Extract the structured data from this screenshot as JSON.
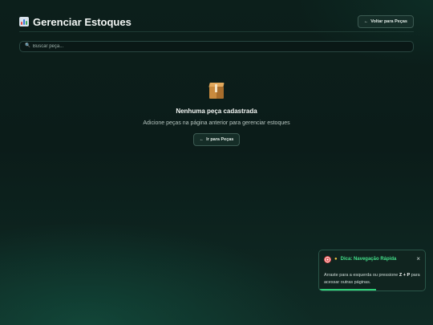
{
  "header": {
    "title": "Gerenciar Estoques",
    "back_label": "Voltar para Peças",
    "back_arrow": "←"
  },
  "search": {
    "placeholder": "Buscar peça...",
    "value": "",
    "icon": "magnifier-icon"
  },
  "empty_state": {
    "icon": "package-icon",
    "title": "Nenhuma peça cadastrada",
    "subtitle": "Adicione peças na página anterior para gerenciar estoques",
    "button_label": "Ir para Peças",
    "button_arrow": "←"
  },
  "toast": {
    "icons": [
      "target-icon",
      "lightbulb-icon"
    ],
    "title": "Dica: Navegação Rápida",
    "body_before": "Arraste para a esquerda ou pressione ",
    "shortcut": "Z + P",
    "body_after": " para acessar outras páginas.",
    "close": "×",
    "progress": 0.54
  },
  "colors": {
    "accent": "#43e08a",
    "progress": "#2ecf77",
    "background": "#0c1f1b"
  }
}
